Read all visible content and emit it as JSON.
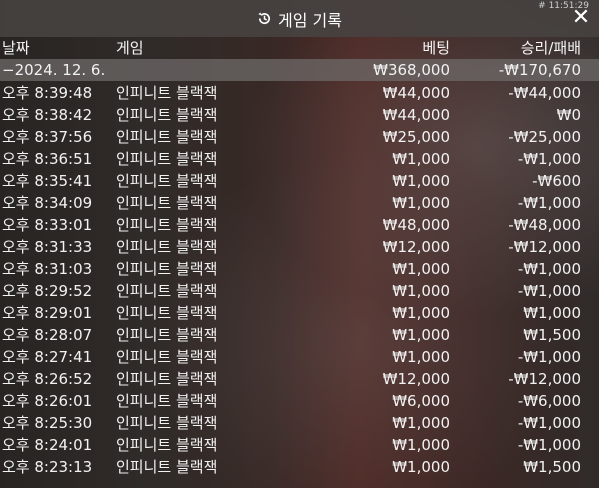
{
  "window": {
    "title": "게임 기록",
    "clock": "# 11:51:29",
    "close_label": "✕"
  },
  "columns": {
    "date": "날짜",
    "game": "게임",
    "bet": "베팅",
    "win_loss": "승리/패배"
  },
  "summary": {
    "date": "−2024. 12. 6.",
    "bet": "₩368,000",
    "win_loss": "-₩170,670"
  },
  "rows": [
    {
      "time": "오후 8:39:48",
      "game": "인피니트 블랙잭",
      "bet": "₩44,000",
      "result": "-₩44,000"
    },
    {
      "time": "오후 8:38:42",
      "game": "인피니트 블랙잭",
      "bet": "₩44,000",
      "result": "₩0"
    },
    {
      "time": "오후 8:37:56",
      "game": "인피니트 블랙잭",
      "bet": "₩25,000",
      "result": "-₩25,000"
    },
    {
      "time": "오후 8:36:51",
      "game": "인피니트 블랙잭",
      "bet": "₩1,000",
      "result": "-₩1,000"
    },
    {
      "time": "오후 8:35:41",
      "game": "인피니트 블랙잭",
      "bet": "₩1,000",
      "result": "-₩600"
    },
    {
      "time": "오후 8:34:09",
      "game": "인피니트 블랙잭",
      "bet": "₩1,000",
      "result": "-₩1,000"
    },
    {
      "time": "오후 8:33:01",
      "game": "인피니트 블랙잭",
      "bet": "₩48,000",
      "result": "-₩48,000"
    },
    {
      "time": "오후 8:31:33",
      "game": "인피니트 블랙잭",
      "bet": "₩12,000",
      "result": "-₩12,000"
    },
    {
      "time": "오후 8:31:03",
      "game": "인피니트 블랙잭",
      "bet": "₩1,000",
      "result": "-₩1,000"
    },
    {
      "time": "오후 8:29:52",
      "game": "인피니트 블랙잭",
      "bet": "₩1,000",
      "result": "-₩1,000"
    },
    {
      "time": "오후 8:29:01",
      "game": "인피니트 블랙잭",
      "bet": "₩1,000",
      "result": "₩1,000"
    },
    {
      "time": "오후 8:28:07",
      "game": "인피니트 블랙잭",
      "bet": "₩1,000",
      "result": "₩1,500"
    },
    {
      "time": "오후 8:27:41",
      "game": "인피니트 블랙잭",
      "bet": "₩1,000",
      "result": "-₩1,000"
    },
    {
      "time": "오후 8:26:52",
      "game": "인피니트 블랙잭",
      "bet": "₩12,000",
      "result": "-₩12,000"
    },
    {
      "time": "오후 8:26:01",
      "game": "인피니트 블랙잭",
      "bet": "₩6,000",
      "result": "-₩6,000"
    },
    {
      "time": "오후 8:25:30",
      "game": "인피니트 블랙잭",
      "bet": "₩1,000",
      "result": "-₩1,000"
    },
    {
      "time": "오후 8:24:01",
      "game": "인피니트 블랙잭",
      "bet": "₩1,000",
      "result": "-₩1,000"
    },
    {
      "time": "오후 8:23:13",
      "game": "인피니트 블랙잭",
      "bet": "₩1,000",
      "result": "₩1,500"
    }
  ]
}
